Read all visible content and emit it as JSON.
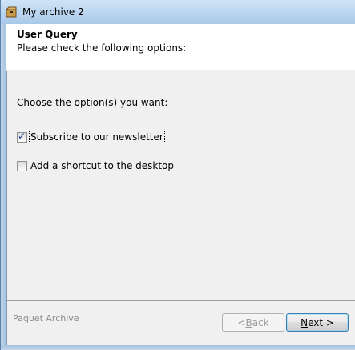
{
  "window": {
    "title": "My archive 2",
    "app_icon": "archive-box-icon"
  },
  "header": {
    "title": "User Query",
    "subtitle": "Please check the following options:"
  },
  "content": {
    "prompt": "Choose the option(s) you want:",
    "options": [
      {
        "label": "Subscribe to our newsletter",
        "checked": true
      },
      {
        "label": "Add a shortcut to the desktop",
        "checked": false
      }
    ]
  },
  "footer": {
    "branding": "Paquet Archive",
    "back_label_pre": "< ",
    "back_label_accel": "B",
    "back_label_post": "ack",
    "next_label_accel": "N",
    "next_label_post": "ext >"
  },
  "colors": {
    "titlebar": "#bcd6f0",
    "dialog_bg": "#f0f0f0",
    "header_bg": "#ffffff",
    "check_tick": "#1c3f94"
  }
}
